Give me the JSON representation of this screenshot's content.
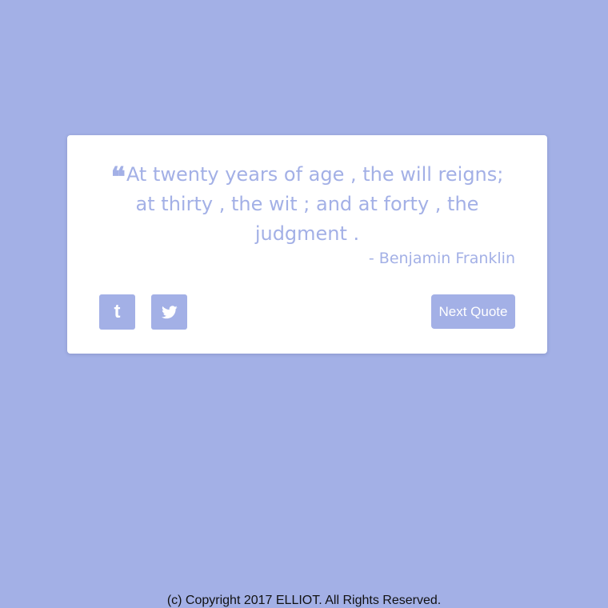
{
  "quote": {
    "icon": "quote-left-icon",
    "mark": "❝",
    "text": "At twenty years of age , the will reigns; at thirty , the wit ; and at forty , the judgment .",
    "author": "- Benjamin Franklin"
  },
  "actions": {
    "tumblr_icon": "tumblr-icon",
    "tumblr_glyph": "t",
    "twitter_icon": "twitter-icon",
    "next_label": "Next Quote"
  },
  "footer": {
    "text": "(c) Copyright 2017 ELLIOT. All Rights Reserved."
  },
  "colors": {
    "background": "#a3b0e6",
    "card": "#ffffff",
    "accent": "#a3b0e6",
    "footer_text": "#111111"
  }
}
